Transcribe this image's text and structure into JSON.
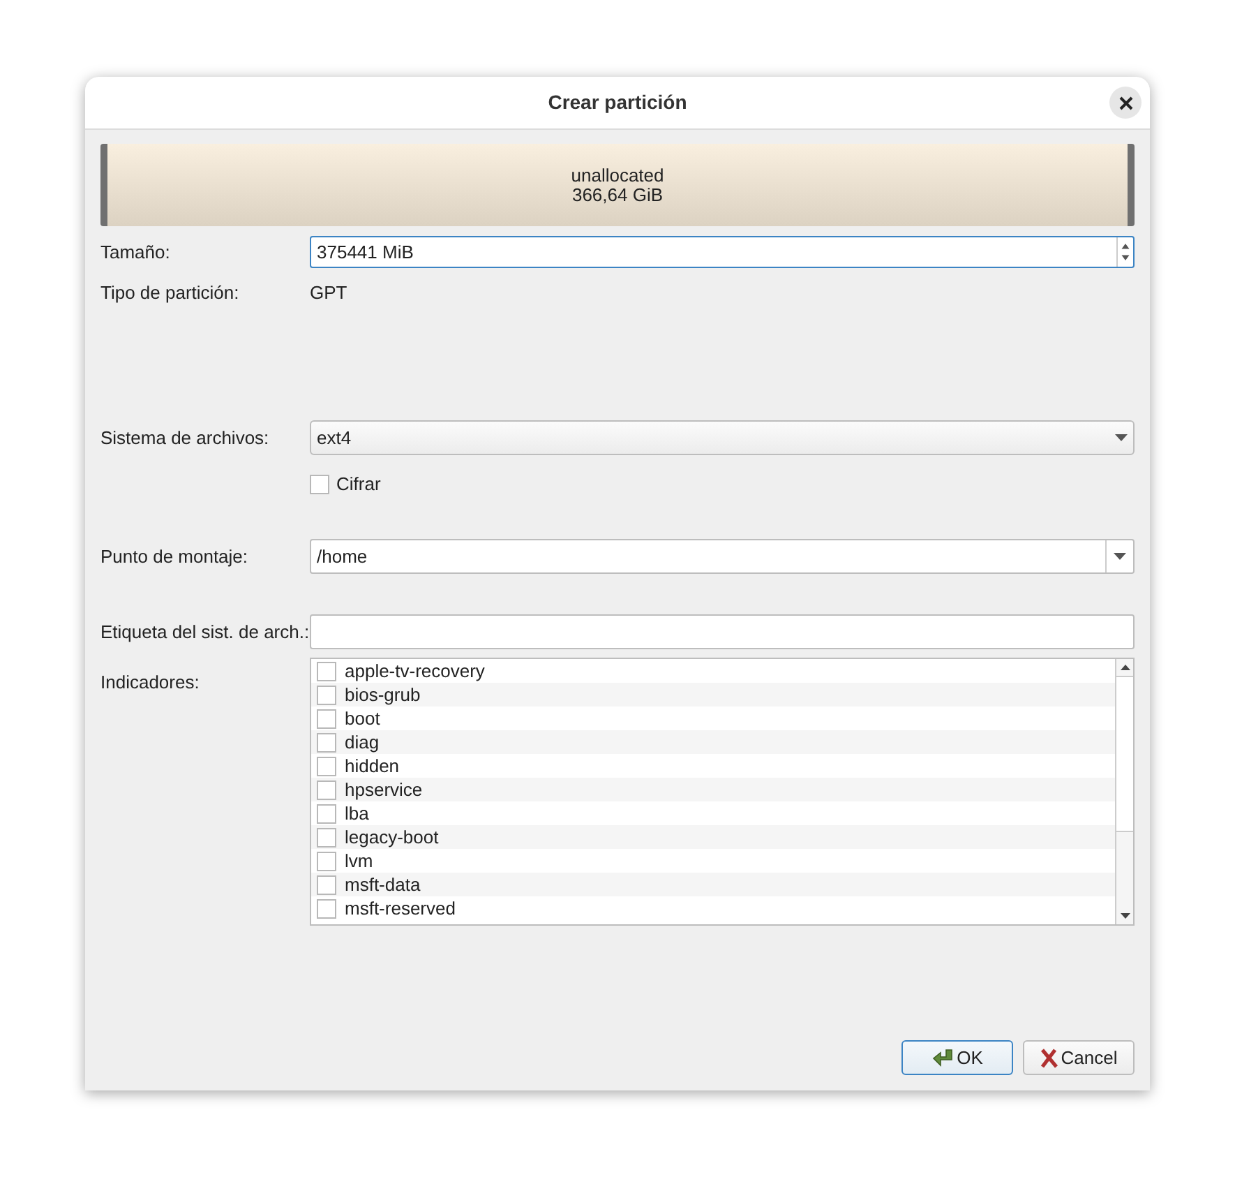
{
  "window": {
    "title": "Crear partición"
  },
  "partition": {
    "name": "unallocated",
    "size": "366,64 GiB"
  },
  "size": {
    "label": "Tamaño:",
    "value": "375441 MiB"
  },
  "partition_type": {
    "label": "Tipo de partición:",
    "value": "GPT"
  },
  "filesystem": {
    "label": "Sistema de archivos:",
    "value": "ext4"
  },
  "encrypt": {
    "label": "Cifrar",
    "checked": false
  },
  "mount_point": {
    "label": "Punto de montaje:",
    "value": "/home"
  },
  "fs_label": {
    "label": "Etiqueta del sist. de arch.:"
  },
  "flags": {
    "label": "Indicadores:",
    "items": [
      {
        "name": "apple-tv-recovery",
        "checked": false
      },
      {
        "name": "bios-grub",
        "checked": false
      },
      {
        "name": "boot",
        "checked": false
      },
      {
        "name": "diag",
        "checked": false
      },
      {
        "name": "hidden",
        "checked": false
      },
      {
        "name": "hpservice",
        "checked": false
      },
      {
        "name": "lba",
        "checked": false
      },
      {
        "name": "legacy-boot",
        "checked": false
      },
      {
        "name": "lvm",
        "checked": false
      },
      {
        "name": "msft-data",
        "checked": false
      },
      {
        "name": "msft-reserved",
        "checked": false
      }
    ]
  },
  "buttons": [
    {
      "kind": "ok",
      "label": "OK"
    },
    {
      "kind": "cancel",
      "label": "Cancel"
    }
  ]
}
